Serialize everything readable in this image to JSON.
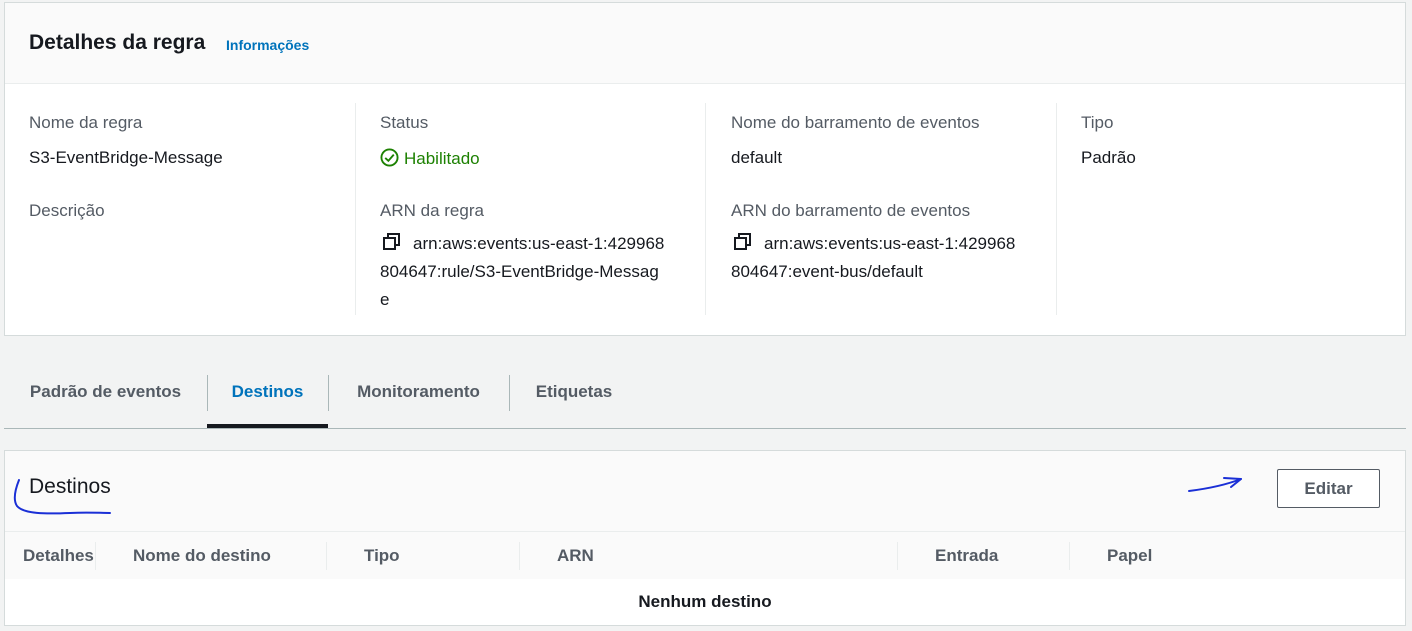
{
  "details": {
    "title": "Detalhes da regra",
    "info_link": "Informações",
    "rule_name_label": "Nome da regra",
    "rule_name_value": "S3-EventBridge-Message",
    "description_label": "Descrição",
    "status_label": "Status",
    "status_value": "Habilitado",
    "rule_arn_label": "ARN da regra",
    "rule_arn_line1": "arn:aws:events:us-east-1:429968",
    "rule_arn_line2": "804647:rule/S3-EventBridge-Messag",
    "rule_arn_line3": "e",
    "bus_name_label": "Nome do barramento de eventos",
    "bus_name_value": "default",
    "bus_arn_label": "ARN do barramento de eventos",
    "bus_arn_line1": "arn:aws:events:us-east-1:429968",
    "bus_arn_line2": "804647:event-bus/default",
    "type_label": "Tipo",
    "type_value": "Padrão"
  },
  "tabs": [
    {
      "label": "Padrão de eventos",
      "active": false
    },
    {
      "label": "Destinos",
      "active": true
    },
    {
      "label": "Monitoramento",
      "active": false
    },
    {
      "label": "Etiquetas",
      "active": false
    }
  ],
  "targets": {
    "title": "Destinos",
    "edit_label": "Editar",
    "columns": [
      "Detalhes",
      "Nome do destino",
      "Tipo",
      "ARN",
      "Entrada",
      "Papel"
    ],
    "empty_message": "Nenhum destino"
  },
  "colors": {
    "link": "#0073bb",
    "success": "#1d8102",
    "annotation": "#1a2fd6"
  },
  "icons": [
    "success-check-icon",
    "copy-icon"
  ]
}
